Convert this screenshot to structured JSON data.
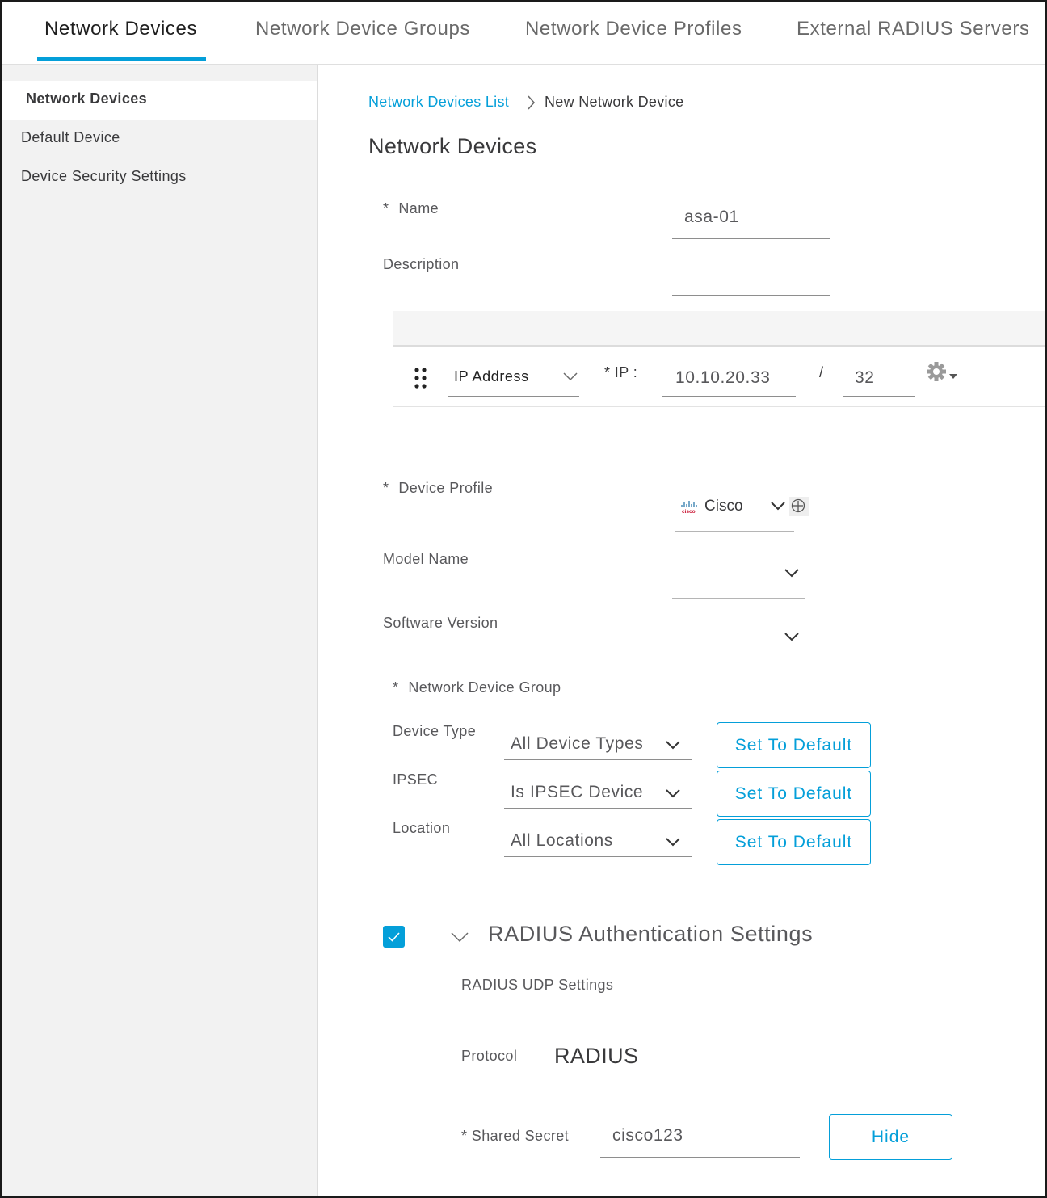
{
  "tabs": [
    "Network Devices",
    "Network Device Groups",
    "Network Device Profiles",
    "External RADIUS Servers"
  ],
  "sidebar": {
    "items": [
      "Network Devices",
      "Default Device",
      "Device Security Settings"
    ]
  },
  "breadcrumb": {
    "link": "Network Devices List",
    "current": "New Network Device"
  },
  "page_title": "Network Devices",
  "form": {
    "name_label": "Name",
    "name_value": "asa-01",
    "description_label": "Description",
    "description_value": "",
    "ip_type": "IP Address",
    "ip_label": "* IP :",
    "ip_value": "10.10.20.33",
    "slash": "/",
    "mask_value": "32",
    "device_profile_label": "Device Profile",
    "device_profile_value": "Cisco",
    "device_profile_logo": "cisco",
    "model_name_label": "Model Name",
    "model_name_value": "",
    "software_version_label": "Software Version",
    "software_version_value": "",
    "ndg_label": "Network Device Group",
    "ndg": [
      {
        "label": "Device Type",
        "value": "All Device Types",
        "button": "Set To Default"
      },
      {
        "label": "IPSEC",
        "value": "Is IPSEC Device",
        "button": "Set To Default"
      },
      {
        "label": "Location",
        "value": "All Locations",
        "button": "Set To Default"
      }
    ]
  },
  "radius": {
    "title": "RADIUS Authentication Settings",
    "checked": true,
    "udp_label": "RADIUS UDP Settings",
    "protocol_label": "Protocol",
    "protocol_value": "RADIUS",
    "secret_label": "* Shared Secret",
    "secret_value": "cisco123",
    "hide_button": "Hide"
  },
  "colors": {
    "accent": "#049fd9",
    "sidebar_bg": "#f2f2f2"
  }
}
